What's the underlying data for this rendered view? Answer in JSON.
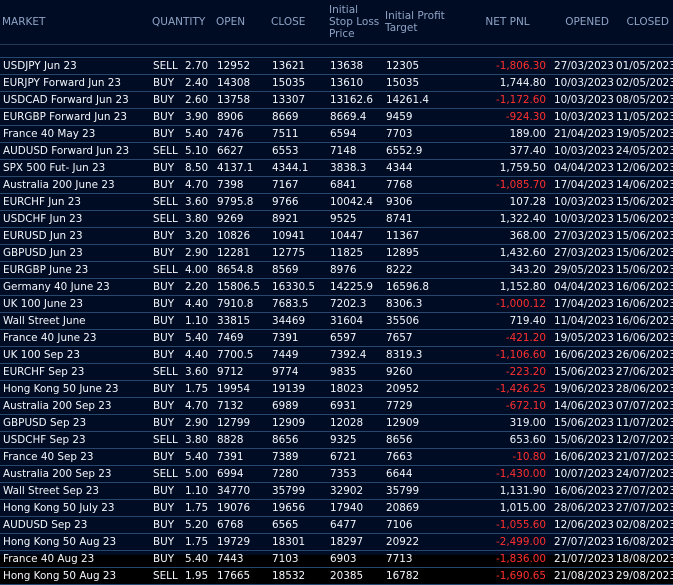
{
  "header": {
    "market": "MARKET",
    "quantity": "QUANTITY",
    "open": "OPEN",
    "close": "CLOSE",
    "initial_stop_loss": "Initial Stop Loss Price",
    "initial_profit_target": "Initial Profit Target",
    "net_pnl": "NET PNL",
    "opened": "OPENED",
    "closed": "CLOSED"
  },
  "rows": [
    [
      "USDJPY Jun 23",
      "SELL",
      "2.70",
      "12952",
      "13621",
      "13638",
      "12305",
      "-1,806.30",
      "27/03/2023",
      "01/05/2023"
    ],
    [
      "EURJPY Forward Jun 23",
      "BUY",
      "2.40",
      "14308",
      "15035",
      "13610",
      "15035",
      "1,744.80",
      "10/03/2023",
      "02/05/2023"
    ],
    [
      "USDCAD Forward Jun 23",
      "BUY",
      "2.60",
      "13758",
      "13307",
      "13162.6",
      "14261.4",
      "-1,172.60",
      "10/03/2023",
      "08/05/2023"
    ],
    [
      "EURGBP Forward Jun 23",
      "BUY",
      "3.90",
      "8906",
      "8669",
      "8669.4",
      "9459",
      "-924.30",
      "10/03/2023",
      "11/05/2023"
    ],
    [
      "France 40 May 23",
      "BUY",
      "5.40",
      "7476",
      "7511",
      "6594",
      "7703",
      "189.00",
      "21/04/2023",
      "19/05/2023"
    ],
    [
      "AUDUSD Forward Jun 23",
      "SELL",
      "5.10",
      "6627",
      "6553",
      "7148",
      "6552.9",
      "377.40",
      "10/03/2023",
      "24/05/2023"
    ],
    [
      "SPX 500 Fut- Jun 23",
      "BUY",
      "8.50",
      "4137.1",
      "4344.1",
      "3838.3",
      "4344",
      "1,759.50",
      "04/04/2023",
      "12/06/2023"
    ],
    [
      "Australia 200 June 23",
      "BUY",
      "4.70",
      "7398",
      "7167",
      "6841",
      "7768",
      "-1,085.70",
      "17/04/2023",
      "14/06/2023"
    ],
    [
      "EURCHF Jun 23",
      "SELL",
      "3.60",
      "9795.8",
      "9766",
      "10042.4",
      "9306",
      "107.28",
      "10/03/2023",
      "15/06/2023"
    ],
    [
      "USDCHF Jun 23",
      "SELL",
      "3.80",
      "9269",
      "8921",
      "9525",
      "8741",
      "1,322.40",
      "10/03/2023",
      "15/06/2023"
    ],
    [
      "EURUSD Jun 23",
      "BUY",
      "3.20",
      "10826",
      "10941",
      "10447",
      "11367",
      "368.00",
      "27/03/2023",
      "15/06/2023"
    ],
    [
      "GBPUSD Jun 23",
      "BUY",
      "2.90",
      "12281",
      "12775",
      "11825",
      "12895",
      "1,432.60",
      "27/03/2023",
      "15/06/2023"
    ],
    [
      "EURGBP June 23",
      "SELL",
      "4.00",
      "8654.8",
      "8569",
      "8976",
      "8222",
      "343.20",
      "29/05/2023",
      "15/06/2023"
    ],
    [
      "Germany 40 June 23",
      "BUY",
      "2.20",
      "15806.5",
      "16330.5",
      "14225.9",
      "16596.8",
      "1,152.80",
      "04/04/2023",
      "16/06/2023"
    ],
    [
      "UK 100 June 23",
      "BUY",
      "4.40",
      "7910.8",
      "7683.5",
      "7202.3",
      "8306.3",
      "-1,000.12",
      "17/04/2023",
      "16/06/2023"
    ],
    [
      "Wall Street June",
      "BUY",
      "1.10",
      "33815",
      "34469",
      "31604",
      "35506",
      "719.40",
      "11/04/2023",
      "16/06/2023"
    ],
    [
      "France 40 June 23",
      "BUY",
      "5.40",
      "7469",
      "7391",
      "6597",
      "7657",
      "-421.20",
      "19/05/2023",
      "16/06/2023"
    ],
    [
      "UK 100 Sep 23",
      "BUY",
      "4.40",
      "7700.5",
      "7449",
      "7392.4",
      "8319.3",
      "-1,106.60",
      "16/06/2023",
      "26/06/2023"
    ],
    [
      "EURCHF Sep 23",
      "SELL",
      "3.60",
      "9712",
      "9774",
      "9835",
      "9260",
      "-223.20",
      "15/06/2023",
      "27/06/2023"
    ],
    [
      "Hong Kong 50 June 23",
      "BUY",
      "1.75",
      "19954",
      "19139",
      "18023",
      "20952",
      "-1,426.25",
      "19/06/2023",
      "28/06/2023"
    ],
    [
      "Australia 200 Sep 23",
      "BUY",
      "4.70",
      "7132",
      "6989",
      "6931",
      "7729",
      "-672.10",
      "14/06/2023",
      "07/07/2023"
    ],
    [
      "GBPUSD Sep 23",
      "BUY",
      "2.90",
      "12799",
      "12909",
      "12028",
      "12909",
      "319.00",
      "15/06/2023",
      "11/07/2023"
    ],
    [
      "USDCHF Sep 23",
      "SELL",
      "3.80",
      "8828",
      "8656",
      "9325",
      "8656",
      "653.60",
      "15/06/2023",
      "12/07/2023"
    ],
    [
      "France 40 Sep 23",
      "BUY",
      "5.40",
      "7391",
      "7389",
      "6721",
      "7663",
      "-10.80",
      "16/06/2023",
      "21/07/2023"
    ],
    [
      "Australia 200 Sep 23",
      "SELL",
      "5.00",
      "6994",
      "7280",
      "7353",
      "6644",
      "-1,430.00",
      "10/07/2023",
      "24/07/2023"
    ],
    [
      "Wall Street Sep 23",
      "BUY",
      "1.10",
      "34770",
      "35799",
      "32902",
      "35799",
      "1,131.90",
      "16/06/2023",
      "27/07/2023"
    ],
    [
      "Hong Kong 50 July 23",
      "BUY",
      "1.75",
      "19076",
      "19656",
      "17940",
      "20869",
      "1,015.00",
      "28/06/2023",
      "27/07/2023"
    ],
    [
      "AUDUSD Sep 23",
      "BUY",
      "5.20",
      "6768",
      "6565",
      "6477",
      "7106",
      "-1,055.60",
      "12/06/2023",
      "02/08/2023"
    ],
    [
      "Hong Kong 50 Aug 23",
      "BUY",
      "1.75",
      "19729",
      "18301",
      "18297",
      "20922",
      "-2,499.00",
      "27/07/2023",
      "16/08/2023"
    ],
    [
      "France 40 Aug 23",
      "BUY",
      "5.40",
      "7443",
      "7103",
      "6903",
      "7713",
      "-1,836.00",
      "21/07/2023",
      "18/08/2023"
    ],
    [
      "Hong Kong 50 Aug 23",
      "SELL",
      "1.95",
      "17665",
      "18532",
      "20385",
      "16782",
      "-1,690.65",
      "21/08/2023",
      "29/08/2023"
    ]
  ],
  "colors": {
    "background": "#000c24",
    "negative": "#ff2f2f",
    "header_text": "#8fa3c6",
    "grid": "#26486f"
  }
}
